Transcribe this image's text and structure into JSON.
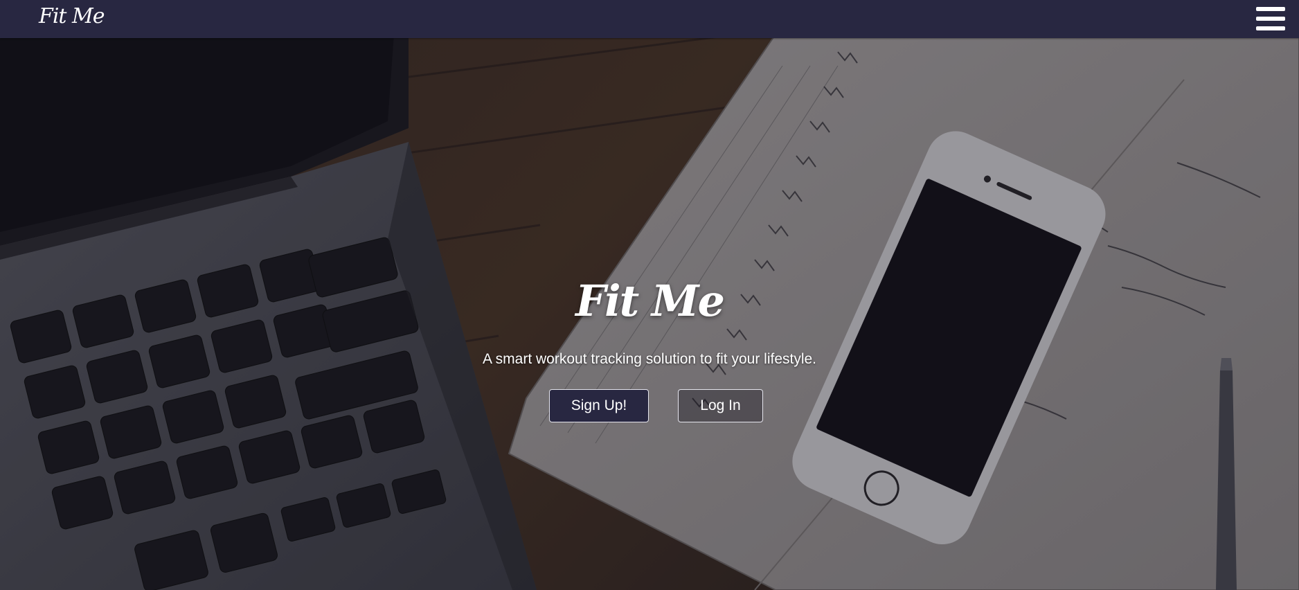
{
  "navbar": {
    "brand": "Fit Me",
    "menu_icon": "hamburger-menu-icon"
  },
  "hero": {
    "title": "Fit Me",
    "tagline": "A smart workout tracking solution to fit your lifestyle.",
    "signup_label": "Sign Up!",
    "login_label": "Log In",
    "background_image": "laptop-phone-notebook-desk-photo"
  },
  "colors": {
    "navbar_bg": "#282741",
    "signup_bg": "#282741",
    "text": "#ffffff"
  }
}
